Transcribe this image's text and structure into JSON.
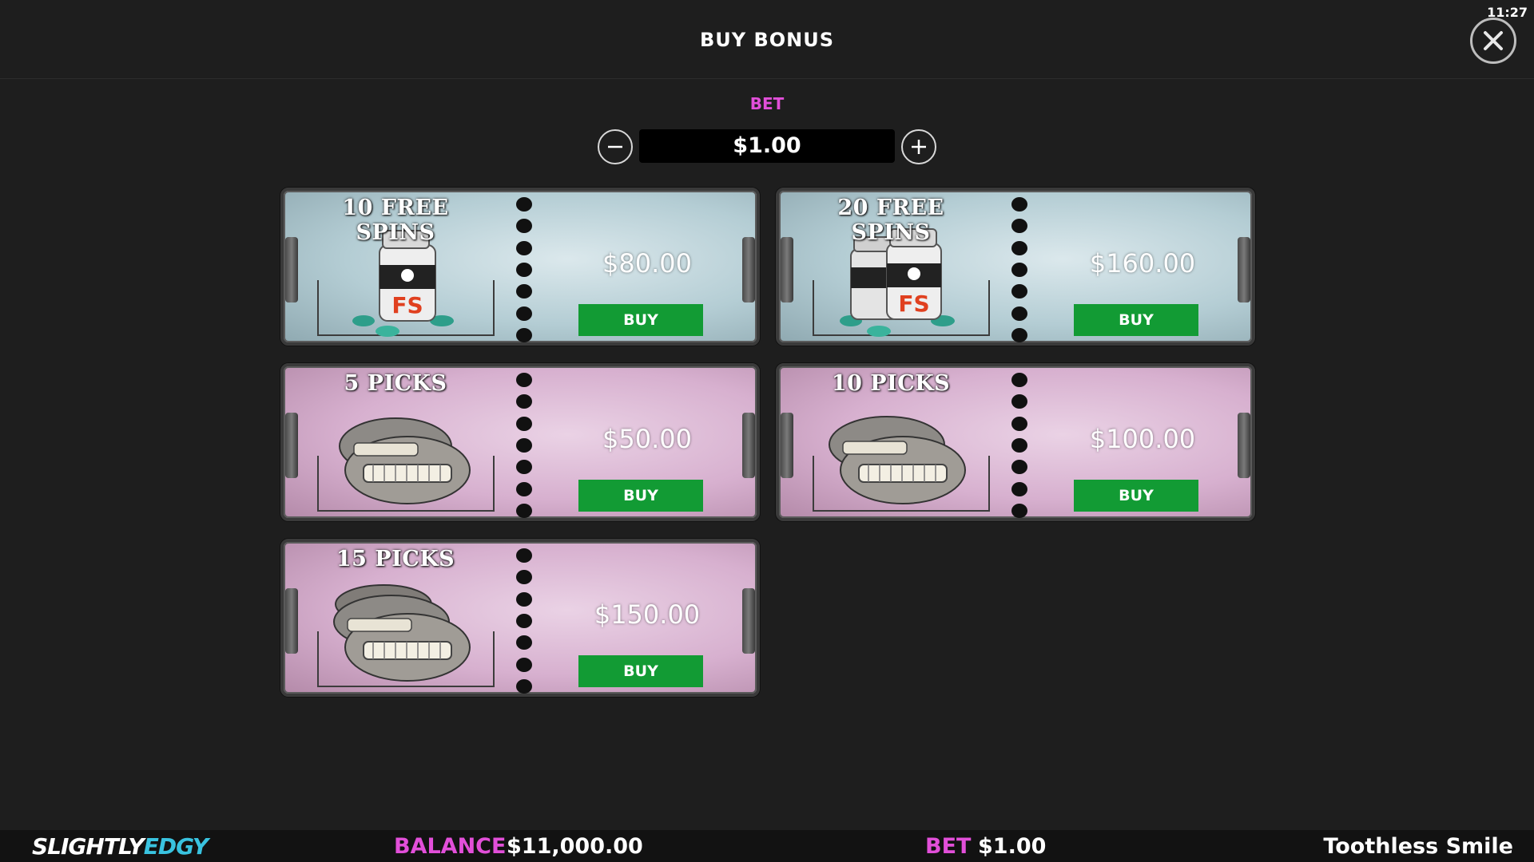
{
  "header": {
    "title": "BUY BONUS",
    "clock": "11:27",
    "close_icon": "close-icon"
  },
  "bet": {
    "label": "BET",
    "value": "$1.00",
    "minus_icon": "minus-icon",
    "plus_icon": "plus-icon"
  },
  "cards": [
    {
      "title": "10 FREE SPINS",
      "price": "$80.00",
      "buy_label": "BUY",
      "theme": "blue",
      "art": "fs-jar-icon"
    },
    {
      "title": "20 FREE SPINS",
      "price": "$160.00",
      "buy_label": "BUY",
      "theme": "blue",
      "art": "fs-jars-icon"
    },
    {
      "title": "5 PICKS",
      "price": "$50.00",
      "buy_label": "BUY",
      "theme": "pink",
      "art": "dentures-icon"
    },
    {
      "title": "10 PICKS",
      "price": "$100.00",
      "buy_label": "BUY",
      "theme": "pink",
      "art": "dentures-icon"
    },
    {
      "title": "15 PICKS",
      "price": "$150.00",
      "buy_label": "BUY",
      "theme": "pink",
      "art": "dentures-stack-icon"
    }
  ],
  "footer": {
    "logo_part1": "SLIGHTLY",
    "logo_part2": "EDGY",
    "balance_label": "BALANCE",
    "balance_value": "$11,000.00",
    "bet_label": "BET",
    "bet_value": "$1.00",
    "game_name": "Toothless Smile"
  },
  "colors": {
    "accent_pink": "#e24fd9",
    "buy_green": "#129b34",
    "logo_cyan": "#39c3e0",
    "background": "#1e1e1e"
  }
}
